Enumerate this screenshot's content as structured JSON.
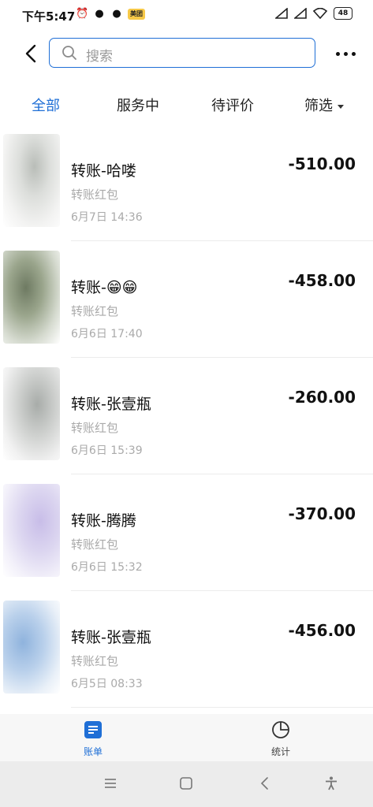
{
  "status_bar": {
    "time": "下午5:47",
    "badge": "美团",
    "battery": "48"
  },
  "search": {
    "placeholder": "搜索"
  },
  "tabs": [
    {
      "label": "全部",
      "active": true
    },
    {
      "label": "服务中",
      "active": false
    },
    {
      "label": "待评价",
      "active": false
    },
    {
      "label": "筛选",
      "active": false
    }
  ],
  "transactions": [
    {
      "name": "转账-哈喽",
      "type": "转账红包",
      "date": "6月7日 14:36",
      "amount": "-510.00"
    },
    {
      "name": "转账-😁😁",
      "type": "转账红包",
      "date": "6月6日 17:40",
      "amount": "-458.00"
    },
    {
      "name": "转账-张壹瓶",
      "type": "转账红包",
      "date": "6月6日 15:39",
      "amount": "-260.00"
    },
    {
      "name": "转账-腾腾",
      "type": "转账红包",
      "date": "6月6日 15:32",
      "amount": "-370.00"
    },
    {
      "name": "转账-张壹瓶",
      "type": "转账红包",
      "date": "6月5日 08:33",
      "amount": "-456.00"
    }
  ],
  "bottom_nav": [
    {
      "label": "账单",
      "icon": "bill-icon",
      "active": true
    },
    {
      "label": "统计",
      "icon": "pie-chart-icon",
      "active": false
    }
  ],
  "colors": {
    "accent": "#1f6fd6",
    "muted_text": "#aaaaaa"
  }
}
